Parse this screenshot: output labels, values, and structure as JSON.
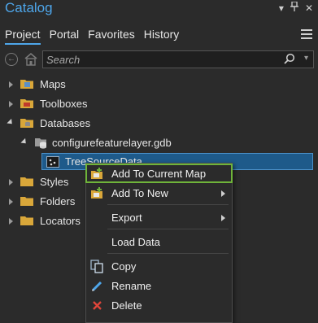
{
  "window": {
    "title": "Catalog"
  },
  "tabs": [
    {
      "label": "Project",
      "active": true
    },
    {
      "label": "Portal",
      "active": false
    },
    {
      "label": "Favorites",
      "active": false
    },
    {
      "label": "History",
      "active": false
    }
  ],
  "search": {
    "placeholder": "Search"
  },
  "tree": {
    "maps": "Maps",
    "toolboxes": "Toolboxes",
    "databases": "Databases",
    "gdb": "configurefeaturelayer.gdb",
    "feature_class": "TreeSourceData",
    "styles": "Styles",
    "folders": "Folders",
    "locators": "Locators"
  },
  "context_menu": {
    "add_to_current_map": "Add To Current Map",
    "add_to_new": "Add To New",
    "export": "Export",
    "load_data": "Load Data",
    "copy": "Copy",
    "rename": "Rename",
    "delete": "Delete"
  },
  "colors": {
    "accent": "#4ea6ea",
    "highlight_border": "#6fb43a",
    "selection": "#1e5a8a",
    "folder": "#d9a73a",
    "delete": "#e0453a"
  }
}
